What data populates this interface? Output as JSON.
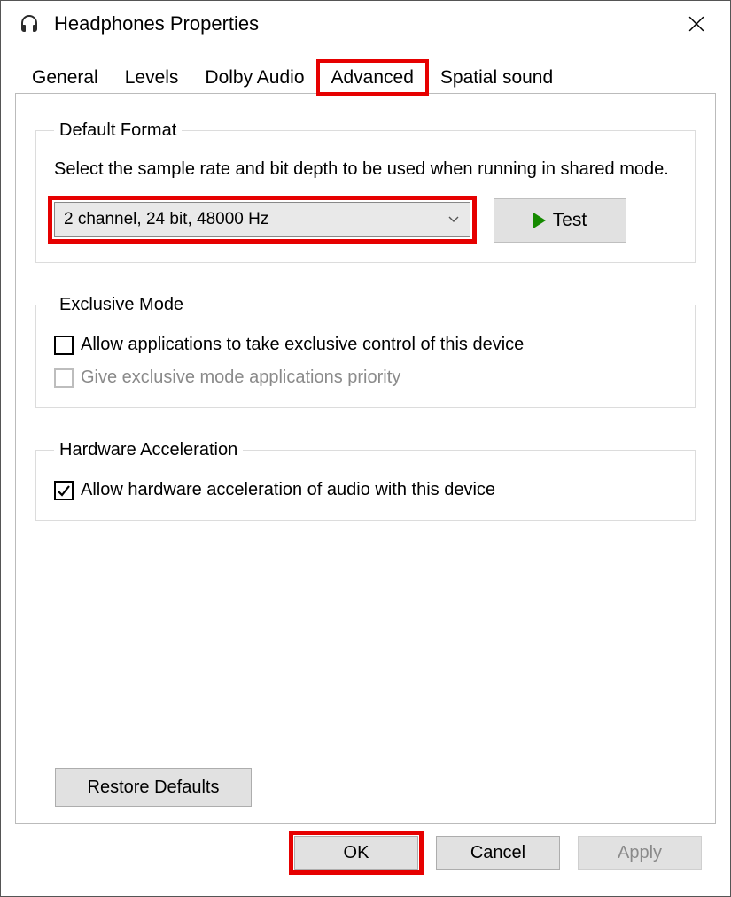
{
  "title": "Headphones Properties",
  "tabs": {
    "general": "General",
    "levels": "Levels",
    "dolby": "Dolby Audio",
    "advanced": "Advanced",
    "spatial": "Spatial sound"
  },
  "default_format": {
    "legend": "Default Format",
    "description": "Select the sample rate and bit depth to be used when running in shared mode.",
    "selected": "2 channel, 24 bit, 48000 Hz",
    "test_label": "Test"
  },
  "exclusive_mode": {
    "legend": "Exclusive Mode",
    "allow_exclusive": "Allow applications to take exclusive control of this device",
    "priority": "Give exclusive mode applications priority"
  },
  "hardware_accel": {
    "legend": "Hardware Acceleration",
    "allow_accel": "Allow hardware acceleration of audio with this device"
  },
  "restore_label": "Restore Defaults",
  "buttons": {
    "ok": "OK",
    "cancel": "Cancel",
    "apply": "Apply"
  }
}
